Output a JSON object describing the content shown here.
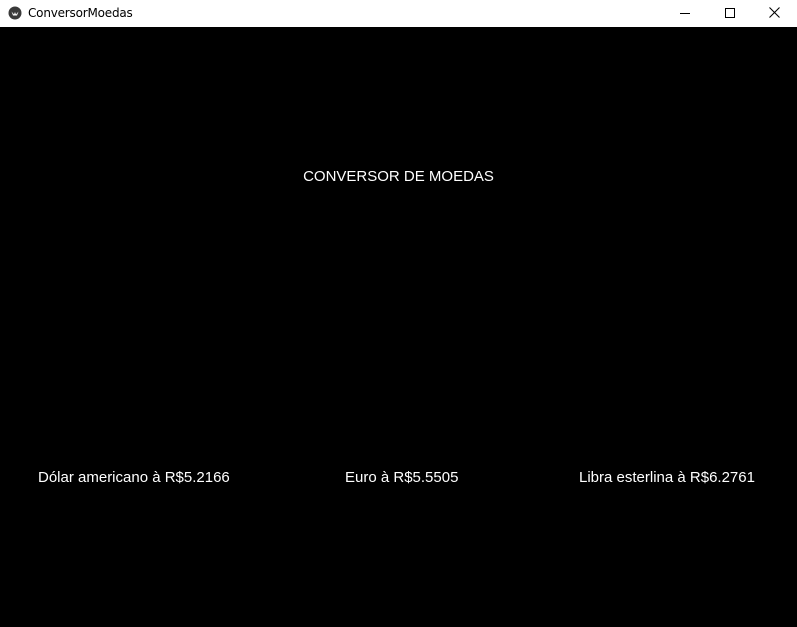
{
  "window": {
    "title": "ConversorMoedas",
    "icon": "kivy-app-icon",
    "controls": {
      "minimize_icon": "minimize-icon",
      "maximize_icon": "maximize-icon",
      "close_icon": "close-icon"
    }
  },
  "main": {
    "heading": "CONVERSOR DE MOEDAS",
    "rates": [
      {
        "label": "Dólar americano à R$5.2166"
      },
      {
        "label": "Euro à R$5.5505"
      },
      {
        "label": "Libra esterlina à R$6.2761"
      }
    ]
  },
  "colors": {
    "background": "#000000",
    "text": "#ffffff",
    "titlebar": "#ffffff"
  }
}
